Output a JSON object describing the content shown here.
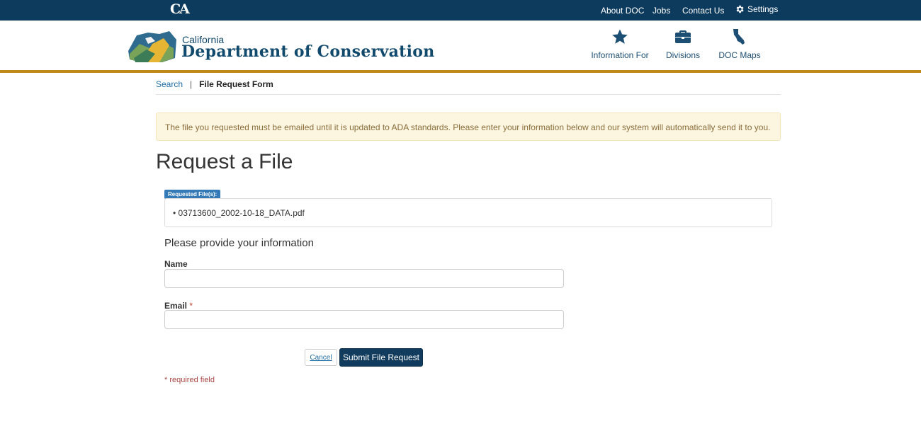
{
  "utility_bar": {
    "ca_logo": "CA",
    "links": [
      "About DOC",
      "Jobs",
      "Contact Us"
    ],
    "settings_label": "Settings"
  },
  "header": {
    "org_small": "California",
    "org_name": "Department of Conservation",
    "nav": [
      {
        "label": "Information For",
        "icon": "star-icon"
      },
      {
        "label": "Divisions",
        "icon": "briefcase-icon"
      },
      {
        "label": "DOC Maps",
        "icon": "california-map-icon"
      }
    ],
    "accent_color": "#c08a1b",
    "brand_color": "#0d3b5e"
  },
  "breadcrumb": {
    "search_link": "Search",
    "separator": "|",
    "current": "File Request Form"
  },
  "alert": {
    "message": "The file you requested must be emailed until it is updated to ADA standards. Please enter your information below and our system will automatically send it to you."
  },
  "page": {
    "title": "Request a File",
    "files_badge": "Requested File(s):",
    "files": [
      "• 03713600_2002-10-18_DATA.pdf"
    ],
    "section_heading": "Please provide your information"
  },
  "form": {
    "name_label": "Name",
    "name_value": "",
    "email_label": "Email",
    "email_required_mark": "*",
    "email_value": "",
    "cancel_label": "Cancel",
    "submit_label": "Submit File Request",
    "required_note": "* required field"
  }
}
